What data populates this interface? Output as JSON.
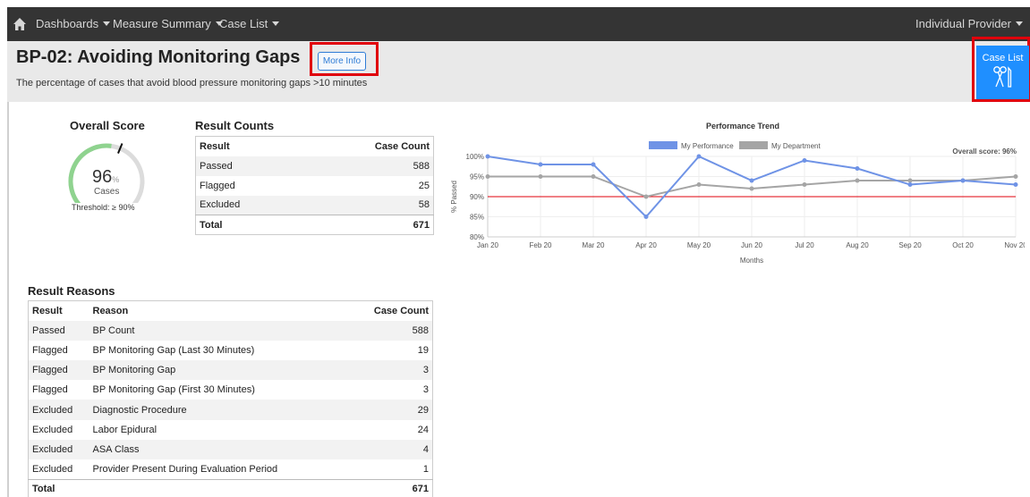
{
  "nav": {
    "items": [
      {
        "label": "Dashboards"
      },
      {
        "label": "Measure Summary"
      },
      {
        "label": "Case List"
      }
    ],
    "user_menu": "Individual Provider"
  },
  "header": {
    "title": "BP-02: Avoiding Monitoring Gaps",
    "more_info": "More Info",
    "subtitle": "The percentage of cases that avoid blood pressure monitoring gaps >10 minutes",
    "case_list_button": "Case List"
  },
  "overall": {
    "title": "Overall Score",
    "score": "96",
    "unit": "%",
    "cases_label": "Cases",
    "threshold": "Threshold: ≥ 90%",
    "fraction": 0.96
  },
  "result_counts": {
    "title": "Result Counts",
    "headers": [
      "Result",
      "Case Count"
    ],
    "rows": [
      {
        "result": "Passed",
        "count": "588"
      },
      {
        "result": "Flagged",
        "count": "25"
      },
      {
        "result": "Excluded",
        "count": "58"
      }
    ],
    "total": {
      "result": "Total",
      "count": "671"
    }
  },
  "result_reasons": {
    "title": "Result Reasons",
    "headers": [
      "Result",
      "Reason",
      "Case Count"
    ],
    "rows": [
      {
        "result": "Passed",
        "reason": "BP Count",
        "count": "588"
      },
      {
        "result": "Flagged",
        "reason": "BP Monitoring Gap (Last 30 Minutes)",
        "count": "19"
      },
      {
        "result": "Flagged",
        "reason": "BP Monitoring Gap",
        "count": "3"
      },
      {
        "result": "Flagged",
        "reason": "BP Monitoring Gap (First 30 Minutes)",
        "count": "3"
      },
      {
        "result": "Excluded",
        "reason": "Diagnostic Procedure",
        "count": "29"
      },
      {
        "result": "Excluded",
        "reason": "Labor Epidural",
        "count": "24"
      },
      {
        "result": "Excluded",
        "reason": "ASA Class",
        "count": "4"
      },
      {
        "result": "Excluded",
        "reason": "Provider Present During Evaluation Period",
        "count": "1"
      }
    ],
    "total": {
      "result": "Total",
      "reason": "",
      "count": "671"
    }
  },
  "chart_data": {
    "type": "line",
    "title": "Performance Trend",
    "xlabel": "Months",
    "ylabel": "% Passed",
    "categories": [
      "Jan 20",
      "Feb 20",
      "Mar 20",
      "Apr 20",
      "May 20",
      "Jun 20",
      "Jul 20",
      "Aug 20",
      "Sep 20",
      "Oct 20",
      "Nov 20"
    ],
    "series": [
      {
        "name": "My Performance",
        "color": "#6f93e6",
        "values": [
          100,
          98,
          98,
          85,
          100,
          94,
          99,
          97,
          93,
          94,
          93
        ]
      },
      {
        "name": "My Department",
        "color": "#a5a5a5",
        "values": [
          95,
          95,
          95,
          90,
          93,
          92,
          93,
          94,
          94,
          94,
          95
        ]
      }
    ],
    "threshold": {
      "value": 90,
      "color": "#e0000b"
    },
    "ylim": [
      80,
      100
    ],
    "yticks": [
      "80%",
      "85%",
      "90%",
      "95%",
      "100%"
    ],
    "overall_label": "Overall score: 96%",
    "legend_position": "top"
  }
}
